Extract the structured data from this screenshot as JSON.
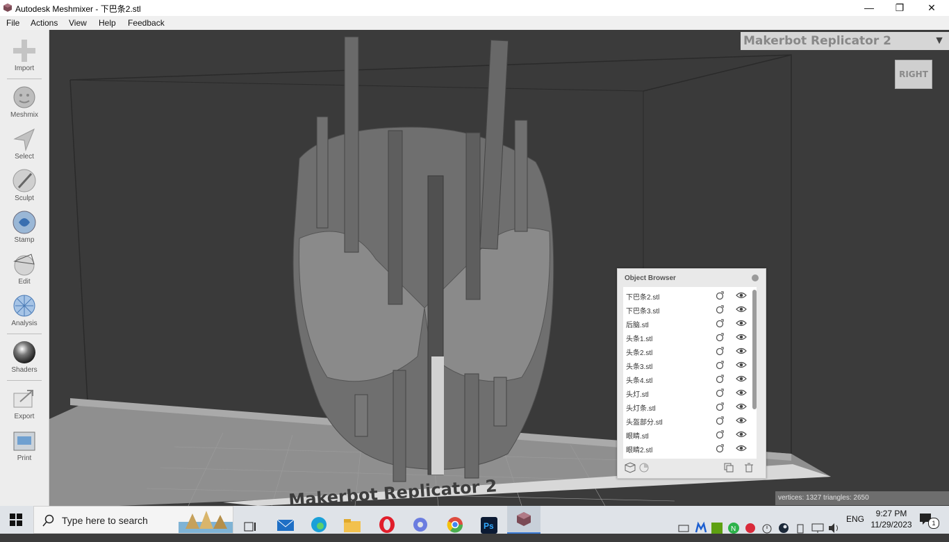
{
  "window": {
    "title": "Autodesk Meshmixer - 下巴条2.stl",
    "min_icon": "minimize-icon",
    "max_icon": "maximize-icon",
    "close_icon": "close-icon"
  },
  "menu": [
    "File",
    "Actions",
    "View",
    "Help",
    "Feedback"
  ],
  "tools": [
    {
      "label": "Import",
      "icon": "plus-icon"
    },
    {
      "label": "Meshmix",
      "icon": "meshmix-icon"
    },
    {
      "label": "Select",
      "icon": "select-arrow-icon"
    },
    {
      "label": "Sculpt",
      "icon": "brush-icon"
    },
    {
      "label": "Stamp",
      "icon": "stamp-icon"
    },
    {
      "label": "Edit",
      "icon": "edit-sphere-icon"
    },
    {
      "label": "Analysis",
      "icon": "analysis-icon"
    },
    {
      "label": "Shaders",
      "icon": "shader-sphere-icon"
    },
    {
      "label": "Export",
      "icon": "export-icon"
    },
    {
      "label": "Print",
      "icon": "printer-icon"
    }
  ],
  "printer": {
    "name": "Makerbot Replicator 2",
    "platform_label": "Makerbot Replicator 2"
  },
  "viewcube": {
    "face": "RIGHT"
  },
  "object_browser": {
    "title": "Object Browser",
    "items": [
      "下巴条2.stl",
      "下巴条3.stl",
      "后脑.stl",
      "头条1.stl",
      "头条2.stl",
      "头条3.stl",
      "头条4.stl",
      "头灯.stl",
      "头灯条.stl",
      "头盔部分.stl",
      "眼睛.stl",
      "眼睛2.stl"
    ]
  },
  "status": {
    "text": "vertices: 1327 triangles: 2650"
  },
  "taskbar": {
    "search_placeholder": "Type here to search",
    "language": "ENG",
    "time": "9:27 PM",
    "date": "11/29/2023",
    "notification_count": "1"
  },
  "colors": {
    "viewport_bg": "#3b3b3b",
    "mesh": "#7a7a7a",
    "toolbar_bg": "#ededed",
    "taskbar_bg": "#dfe3e8"
  }
}
